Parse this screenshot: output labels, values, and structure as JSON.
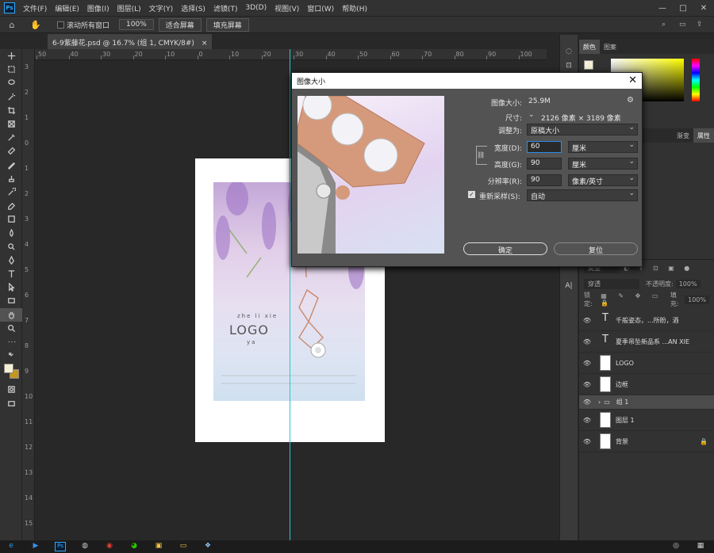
{
  "app": {
    "icon": "Ps"
  },
  "menu": [
    "文件(F)",
    "编辑(E)",
    "图像(I)",
    "图层(L)",
    "文字(Y)",
    "选择(S)",
    "滤镜(T)",
    "3D(D)",
    "视图(V)",
    "窗口(W)",
    "帮助(H)"
  ],
  "window_controls": [
    "—",
    "□",
    "✕"
  ],
  "options": {
    "scroll_all_label": "滚动所有窗口",
    "zoom_value": "100%",
    "fit_screen": "适合屏幕",
    "fill_screen": "填充屏幕"
  },
  "doc_tab": {
    "title": "6-9紫藤花.psd @ 16.7% (组 1, CMYK/8#)",
    "close": "×"
  },
  "hruler": [
    "50",
    "40",
    "30",
    "20",
    "10",
    "0",
    "10",
    "20",
    "30",
    "40",
    "50",
    "60",
    "70",
    "80",
    "90",
    "100"
  ],
  "vruler": [
    "3",
    "2",
    "1",
    "0",
    "1",
    "2",
    "3",
    "4",
    "5",
    "6",
    "7",
    "8",
    "9",
    "10",
    "11",
    "12",
    "13",
    "14",
    "15"
  ],
  "poster": {
    "brand_top": "zhe li xie",
    "logo": "LOGO",
    "brand_bottom": "ya"
  },
  "panels": {
    "color_tabs": [
      "颜色",
      "图案"
    ],
    "props_tabs": [
      "渐变",
      "属性"
    ],
    "layer_filter": "类型",
    "blend_mode": "穿透",
    "opacity_label": "不透明度:",
    "opacity_value": "100%",
    "lock_label": "锁定:",
    "fill_label": "填充:",
    "fill_value": "100%",
    "layers": [
      {
        "name": "千般姿态，...所盼，酒",
        "kind": "text"
      },
      {
        "name": "夏季吊坠新品系 ...AN XIE",
        "kind": "text"
      },
      {
        "name": "LOGO",
        "kind": "image"
      },
      {
        "name": "边框",
        "kind": "image"
      },
      {
        "name": "组 1",
        "kind": "group"
      },
      {
        "name": "图层 1",
        "kind": "image"
      },
      {
        "name": "背景",
        "kind": "image"
      }
    ]
  },
  "dialog": {
    "title": "图像大小",
    "image_size_label": "图像大小:",
    "image_size_value": "25.9M",
    "dimensions_label": "尺寸:",
    "dimensions_value": "2126 像素  ×  3189 像素",
    "fit_label": "调整为:",
    "fit_value": "原稿大小",
    "width_label": "宽度(D):",
    "width_value": "60",
    "width_unit": "厘米",
    "height_label": "高度(G):",
    "height_value": "90",
    "height_unit": "厘米",
    "resolution_label": "分辨率(R):",
    "resolution_value": "90",
    "resolution_unit": "像素/英寸",
    "resample_label": "重新采样(S):",
    "resample_value": "自动",
    "ok_label": "确定",
    "reset_label": "复位"
  },
  "colors": {
    "accent": "#2d8ceb",
    "guide": "#2bc4d0",
    "fg_swatch": "#f4f0d6",
    "bg_swatch": "#c8961e"
  }
}
